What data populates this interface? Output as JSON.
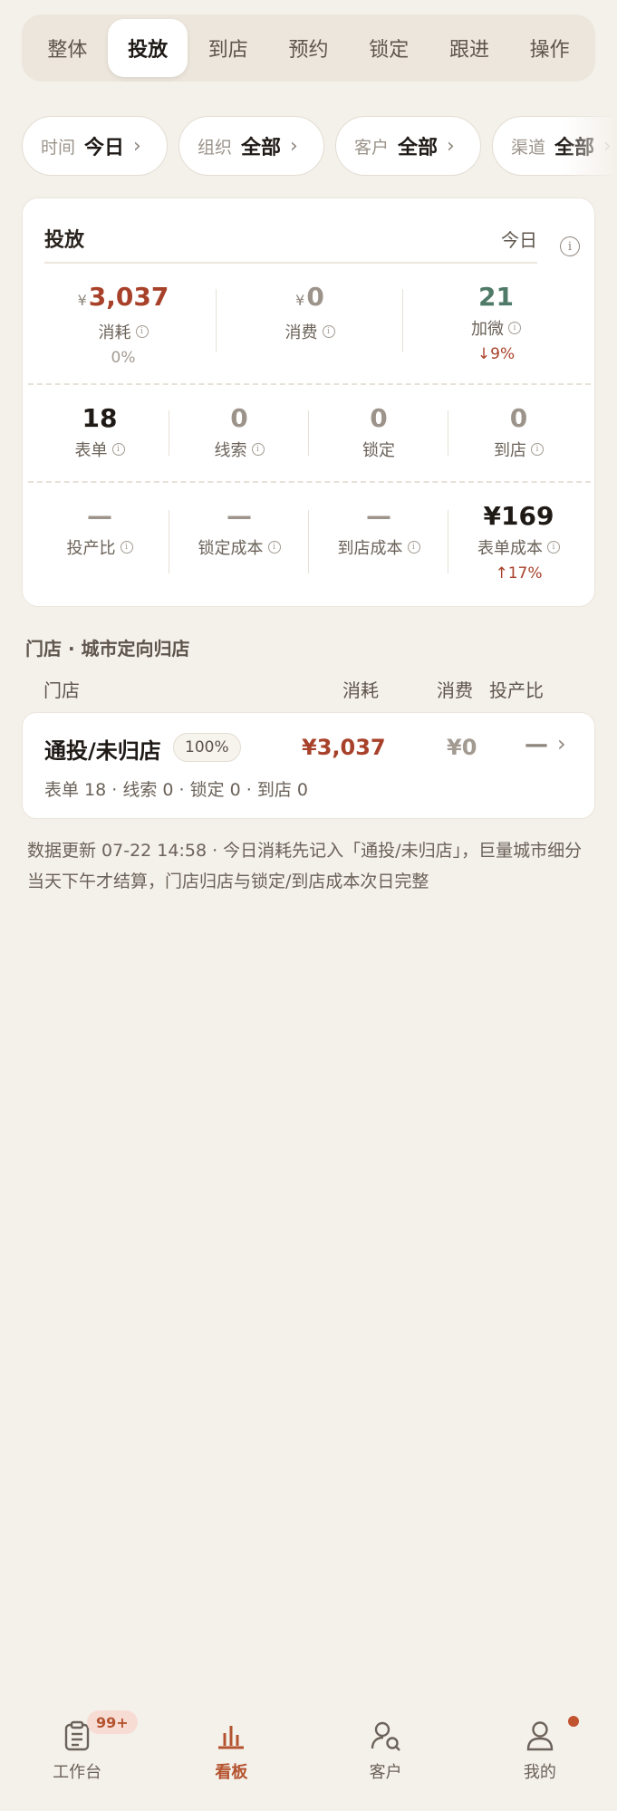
{
  "tabs": [
    "整体",
    "投放",
    "到店",
    "预约",
    "锁定",
    "跟进",
    "操作"
  ],
  "active_tab": 1,
  "filters": [
    {
      "key": "时间",
      "value": "今日"
    },
    {
      "key": "组织",
      "value": "全部"
    },
    {
      "key": "客户",
      "value": "全部"
    },
    {
      "key": "渠道",
      "value": "全部"
    }
  ],
  "card": {
    "title": "投放",
    "period": "今日",
    "row1": [
      {
        "yen": "¥",
        "value": "3,037",
        "label": "消耗",
        "sub": "0%"
      },
      {
        "yen": "¥",
        "value": "0",
        "label": "消费"
      },
      {
        "value": "21",
        "label": "加微",
        "sub": "↓9%"
      }
    ],
    "row2": [
      {
        "value": "18",
        "label": "表单"
      },
      {
        "value": "0",
        "label": "线索"
      },
      {
        "value": "0",
        "label": "锁定"
      },
      {
        "value": "0",
        "label": "到店"
      }
    ],
    "row3": [
      {
        "value": "—",
        "label": "投产比"
      },
      {
        "value": "—",
        "label": "锁定成本"
      },
      {
        "value": "—",
        "label": "到店成本"
      },
      {
        "value": "¥169",
        "label": "表单成本",
        "sub": "↑17%"
      }
    ]
  },
  "section": {
    "title": "门店 · 城市定向归店",
    "headers": {
      "store": "门店",
      "cost": "消耗",
      "spend": "消费",
      "roi": "投产比"
    },
    "store": {
      "name": "通投/未归店",
      "pct": "100%",
      "cost": "¥3,037",
      "spend": "¥0",
      "roi": "—",
      "meta": "表单 18 · 线索 0 · 锁定 0 · 到店 0"
    }
  },
  "note": "数据更新 07-22 14:58 · 今日消耗先记入「通投/未归店」，巨量城市细分当天下午才结算，门店归店与锁定/到店成本次日完整",
  "nav": [
    {
      "label": "工作台",
      "icon": "clipboard-icon",
      "badge": "99+"
    },
    {
      "label": "看板",
      "icon": "bar-chart-icon",
      "active": true
    },
    {
      "label": "客户",
      "icon": "user-search-icon"
    },
    {
      "label": "我的",
      "icon": "user-icon",
      "dot": true
    }
  ],
  "colors": {
    "accent": "#b4532f",
    "cost": "#a8412a",
    "positive": "#4f7a68",
    "background": "#f4f0ea"
  }
}
